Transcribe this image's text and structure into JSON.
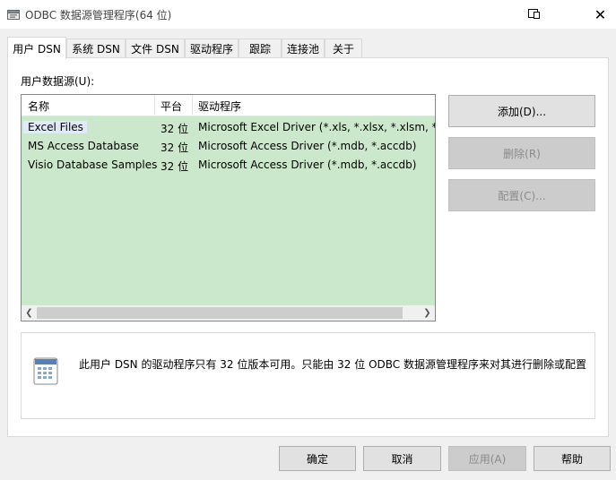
{
  "window": {
    "title": "ODBC 数据源管理程序(64 位)",
    "close_glyph": "✕"
  },
  "tabs": [
    {
      "label": "用户 DSN",
      "active": true
    },
    {
      "label": "系统 DSN",
      "active": false
    },
    {
      "label": "文件 DSN",
      "active": false
    },
    {
      "label": "驱动程序",
      "active": false
    },
    {
      "label": "跟踪",
      "active": false
    },
    {
      "label": "连接池",
      "active": false
    },
    {
      "label": "关于",
      "active": false
    }
  ],
  "panel": {
    "section_label": "用户数据源(U):",
    "columns": [
      "名称",
      "平台",
      "驱动程序"
    ],
    "rows": [
      {
        "name": "Excel Files",
        "platform": "32 位",
        "driver": "Microsoft Excel Driver (*.xls, *.xlsx, *.xlsm, *.xlsb)"
      },
      {
        "name": "MS Access Database",
        "platform": "32 位",
        "driver": "Microsoft Access Driver (*.mdb, *.accdb)"
      },
      {
        "name": "Visio Database Samples",
        "platform": "32 位",
        "driver": "Microsoft Access Driver (*.mdb, *.accdb)"
      }
    ],
    "buttons": {
      "add": "添加(D)...",
      "remove": "删除(R)",
      "configure": "配置(C)..."
    },
    "info_text": "此用户 DSN 的驱动程序只有 32 位版本可用。只能由 32 位 ODBC 数据源管理程序来对其进行删除或配置"
  },
  "footer": {
    "ok": "确定",
    "cancel": "取消",
    "apply": "应用(A)",
    "help": "帮助"
  },
  "colors": {
    "list_background": "#cce8cc",
    "selected_name_highlight": "#e1eaf8"
  }
}
